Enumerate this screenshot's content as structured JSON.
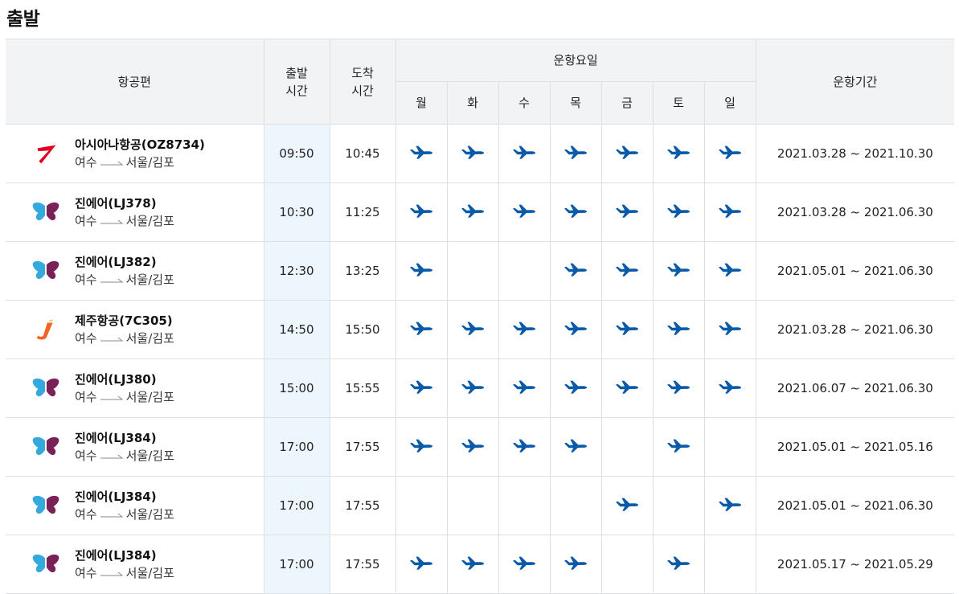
{
  "title": "출발",
  "headers": {
    "flight": "항공편",
    "dep_time": "출발\n시간",
    "arr_time": "도착\n시간",
    "days_group": "운항요일",
    "days": [
      "월",
      "화",
      "수",
      "목",
      "금",
      "토",
      "일"
    ],
    "period": "운항기간"
  },
  "route": {
    "from": "여수",
    "to": "서울/김포"
  },
  "colors": {
    "plane": "#0a5aa8",
    "asiana": "#e3001b",
    "jinair_blue": "#35a8dc",
    "jinair_purple": "#7a2158",
    "jeju": "#f26522"
  },
  "flights": [
    {
      "airline_logo": "asiana-logo",
      "name": "아시아나항공(OZ8734)",
      "dep": "09:50",
      "arr": "10:45",
      "days": [
        1,
        1,
        1,
        1,
        1,
        1,
        1
      ],
      "period": "2021.03.28 ~ 2021.10.30"
    },
    {
      "airline_logo": "jinair-logo",
      "name": "진에어(LJ378)",
      "dep": "10:30",
      "arr": "11:25",
      "days": [
        1,
        1,
        1,
        1,
        1,
        1,
        1
      ],
      "period": "2021.03.28 ~ 2021.06.30"
    },
    {
      "airline_logo": "jinair-logo",
      "name": "진에어(LJ382)",
      "dep": "12:30",
      "arr": "13:25",
      "days": [
        1,
        0,
        0,
        1,
        1,
        1,
        1
      ],
      "period": "2021.05.01 ~ 2021.06.30"
    },
    {
      "airline_logo": "jejuair-logo",
      "name": "제주항공(7C305)",
      "dep": "14:50",
      "arr": "15:50",
      "days": [
        1,
        1,
        1,
        1,
        1,
        1,
        1
      ],
      "period": "2021.03.28 ~ 2021.06.30"
    },
    {
      "airline_logo": "jinair-logo",
      "name": "진에어(LJ380)",
      "dep": "15:00",
      "arr": "15:55",
      "days": [
        1,
        1,
        1,
        1,
        1,
        1,
        1
      ],
      "period": "2021.06.07 ~ 2021.06.30"
    },
    {
      "airline_logo": "jinair-logo",
      "name": "진에어(LJ384)",
      "dep": "17:00",
      "arr": "17:55",
      "days": [
        1,
        1,
        1,
        1,
        0,
        1,
        0
      ],
      "period": "2021.05.01 ~ 2021.05.16"
    },
    {
      "airline_logo": "jinair-logo",
      "name": "진에어(LJ384)",
      "dep": "17:00",
      "arr": "17:55",
      "days": [
        0,
        0,
        0,
        0,
        1,
        0,
        1
      ],
      "period": "2021.05.01 ~ 2021.06.30"
    },
    {
      "airline_logo": "jinair-logo",
      "name": "진에어(LJ384)",
      "dep": "17:00",
      "arr": "17:55",
      "days": [
        1,
        1,
        1,
        1,
        0,
        1,
        0
      ],
      "period": "2021.05.17 ~ 2021.05.29"
    }
  ]
}
